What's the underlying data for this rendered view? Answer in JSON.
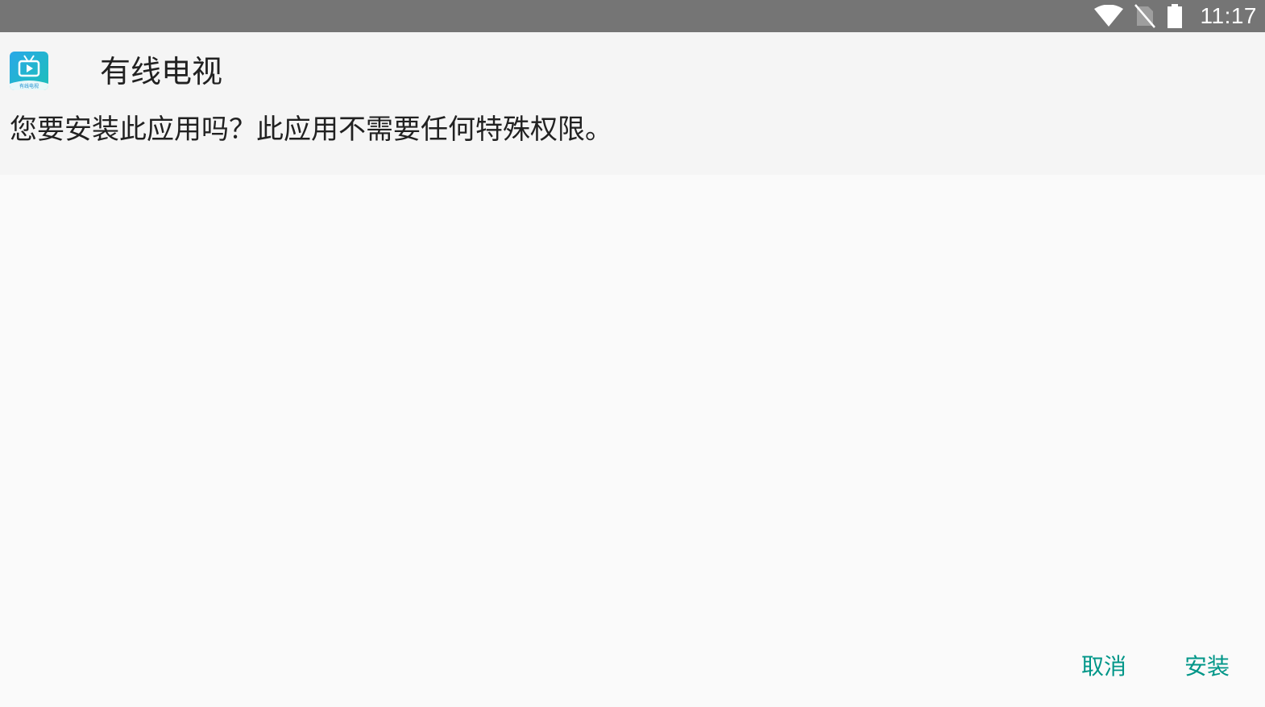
{
  "status_bar": {
    "time": "11:17",
    "icons": [
      "wifi-icon",
      "no-sim-icon",
      "battery-icon"
    ]
  },
  "app": {
    "name": "有线电视",
    "icon": "tv-app-icon",
    "icon_caption": "有线电视"
  },
  "dialog": {
    "prompt": "您要安装此应用吗？此应用不需要任何特殊权限。"
  },
  "actions": {
    "cancel_label": "取消",
    "install_label": "安装"
  },
  "colors": {
    "status_bar": "#757575",
    "accent": "#009688",
    "header_bg": "#f5f5f5",
    "body_bg": "#fafafa"
  }
}
